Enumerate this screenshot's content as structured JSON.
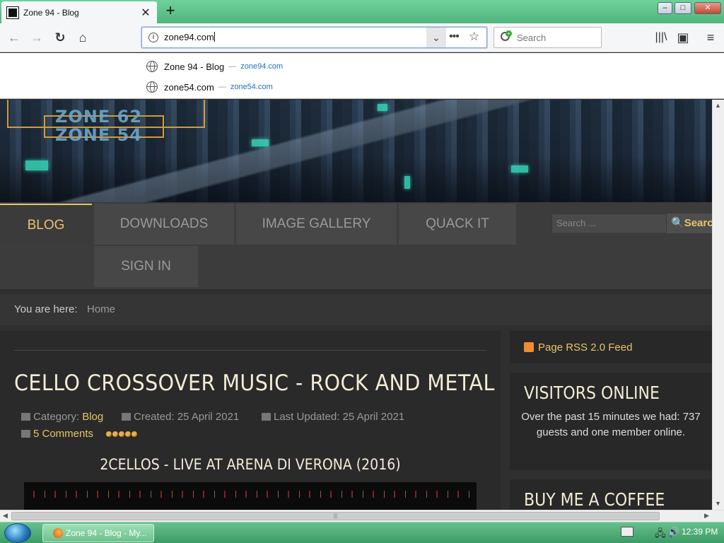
{
  "browser": {
    "tab_title": "Zone 94 - Blog",
    "tab_close": "✕",
    "new_tab": "+",
    "url": "zone94.com",
    "search_placeholder": "Search",
    "window_buttons": {
      "minimize": "–",
      "maximize": "□",
      "close": "✕"
    }
  },
  "autocomplete": [
    {
      "title": "Zone 94 - Blog",
      "sep": "—",
      "url": "zone94.com"
    },
    {
      "title": "zone54.com",
      "sep": "—",
      "url": "zone54.com"
    }
  ],
  "site": {
    "logo_lines": [
      "ZONE 62",
      "ZONE 54"
    ],
    "menu": [
      {
        "label": "BLOG",
        "active": true
      },
      {
        "label": "DOWNLOADS",
        "active": false
      },
      {
        "label": "IMAGE GALLERY",
        "active": false
      },
      {
        "label": "QUACK IT",
        "active": false
      },
      {
        "label": "SIGN IN",
        "active": false
      }
    ],
    "search_placeholder": "Search ...",
    "search_button": "Search",
    "breadcrumb": {
      "label": "You are here:",
      "home": "Home"
    }
  },
  "article": {
    "title": "CELLO CROSSOVER MUSIC - ROCK AND METAL",
    "category_label": "Category:",
    "category": "Blog",
    "created": "Created: 25 April 2021",
    "updated": "Last Updated: 25 April 2021",
    "comments": "5 Comments",
    "rating": 5,
    "subtitle": "2CELLOS - LIVE AT ARENA DI VERONA (2016)"
  },
  "sidebar": {
    "rss": "Page RSS 2.0 Feed",
    "visitors_title": "VISITORS ONLINE",
    "visitors_text": "Over the past 15 minutes we had: 737 guests and one member online.",
    "coffee_title": "BUY ME A COFFEE"
  },
  "taskbar": {
    "task_label": "Zone 94 - Blog - My...",
    "clock": "12:39 PM"
  }
}
